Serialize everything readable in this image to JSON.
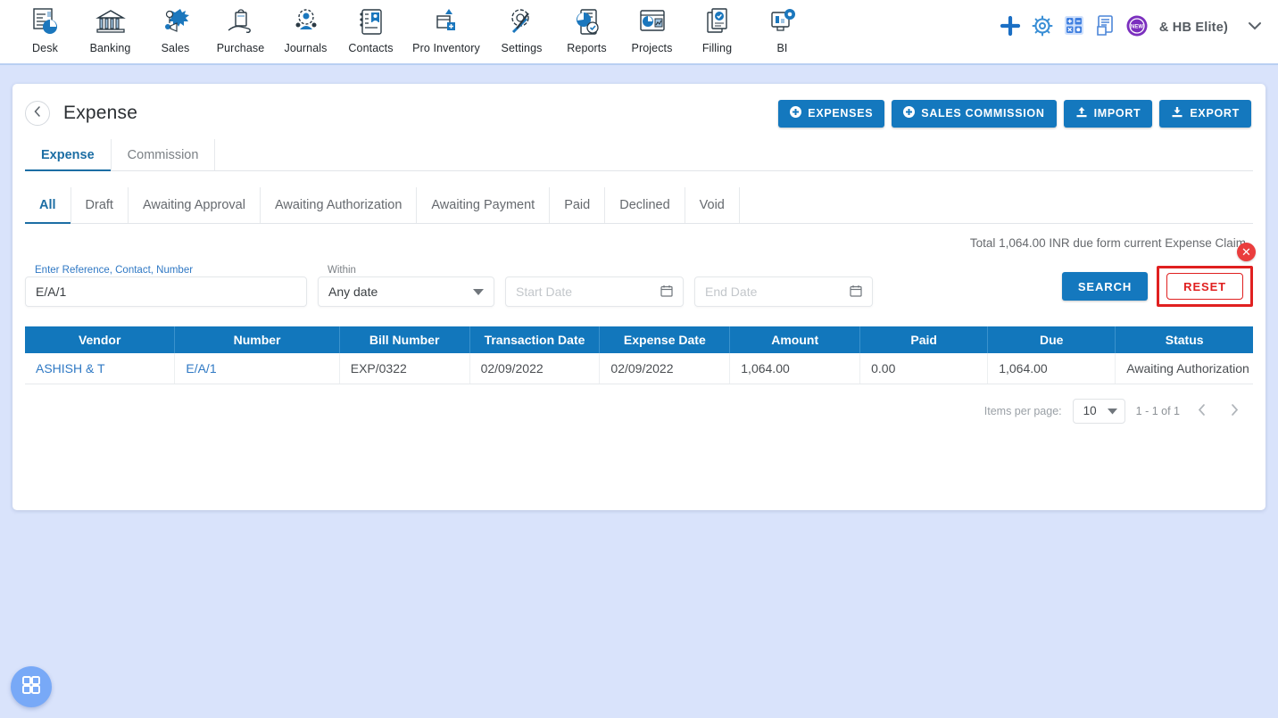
{
  "topnav": {
    "items": [
      {
        "label": "Desk",
        "icon": "desk-dashboard-icon"
      },
      {
        "label": "Banking",
        "icon": "bank-building-icon"
      },
      {
        "label": "Sales",
        "icon": "sales-megaphone-icon"
      },
      {
        "label": "Purchase",
        "icon": "purchase-hand-bag-icon"
      },
      {
        "label": "Journals",
        "icon": "journals-people-gear-icon"
      },
      {
        "label": "Contacts",
        "icon": "contacts-book-icon"
      },
      {
        "label": "Pro Inventory",
        "icon": "inventory-box-icon"
      },
      {
        "label": "Settings",
        "icon": "settings-tools-icon"
      },
      {
        "label": "Reports",
        "icon": "reports-pie-doc-icon"
      },
      {
        "label": "Projects",
        "icon": "projects-board-icon"
      },
      {
        "label": "Filling",
        "icon": "filling-document-icon"
      },
      {
        "label": "BI",
        "icon": "bi-monitor-icon"
      }
    ],
    "right": {
      "add_icon": "plus-icon",
      "settings_icon": "gear-icon",
      "calculator_icon": "calculator-icon",
      "notes_icon": "notes-document-icon",
      "new_badge_icon": "new-badge-icon",
      "user_label": "& HB Elite)",
      "caret_icon": "chevron-down-icon"
    }
  },
  "card": {
    "back_icon": "chevron-left-icon",
    "title": "Expense",
    "actions": [
      {
        "label": "EXPENSES",
        "icon": "plus-circle-icon",
        "name": "expenses-button"
      },
      {
        "label": "SALES COMMISSION",
        "icon": "plus-circle-icon",
        "name": "sales-commission-button"
      },
      {
        "label": "IMPORT",
        "icon": "upload-icon",
        "name": "import-button"
      },
      {
        "label": "EXPORT",
        "icon": "download-icon",
        "name": "export-button"
      }
    ],
    "main_tabs": [
      {
        "label": "Expense",
        "active": true
      },
      {
        "label": "Commission",
        "active": false
      }
    ],
    "status_tabs": [
      {
        "label": "All",
        "active": true
      },
      {
        "label": "Draft",
        "active": false
      },
      {
        "label": "Awaiting Approval",
        "active": false
      },
      {
        "label": "Awaiting Authorization",
        "active": false
      },
      {
        "label": "Awaiting Payment",
        "active": false
      },
      {
        "label": "Paid",
        "active": false
      },
      {
        "label": "Declined",
        "active": false
      },
      {
        "label": "Void",
        "active": false
      }
    ],
    "total_text": "Total 1,064.00 INR due form current Expense Claim",
    "filters": {
      "reference_label": "Enter Reference, Contact, Number",
      "reference_value": "E/A/1",
      "within_label": "Within",
      "within_value": "Any date",
      "within_caret_icon": "dropdown-arrow-icon",
      "start_date_placeholder": "Start Date",
      "start_date_icon": "calendar-icon",
      "end_date_placeholder": "End Date",
      "end_date_icon": "calendar-icon",
      "search_label": "SEARCH",
      "reset_label": "RESET",
      "close_icon": "close-icon"
    },
    "table": {
      "columns": [
        "Vendor",
        "Number",
        "Bill Number",
        "Transaction Date",
        "Expense Date",
        "Amount",
        "Paid",
        "Due",
        "Status"
      ],
      "rows": [
        {
          "vendor": "ASHISH & T",
          "number": "E/A/1",
          "bill_number": "EXP/0322",
          "transaction_date": "02/09/2022",
          "expense_date": "02/09/2022",
          "amount": "1,064.00",
          "paid": "0.00",
          "due": "1,064.00",
          "status": "Awaiting Authorization"
        }
      ]
    },
    "paginator": {
      "items_per_page_label": "Items per page:",
      "items_per_page_value": "10",
      "caret_icon": "dropdown-arrow-icon",
      "range_label": "1 - 1 of 1",
      "prev_icon": "chevron-left-icon",
      "next_icon": "chevron-right-icon"
    }
  },
  "fab": {
    "icon": "grid-apps-icon"
  },
  "colors": {
    "page_background": "#d9e3fb",
    "primary_blue": "#1478be",
    "table_header_blue": "#1277bc",
    "link_blue": "#2f79c4",
    "reset_red": "#e02020",
    "accent_tab": "#1c6ea4"
  }
}
